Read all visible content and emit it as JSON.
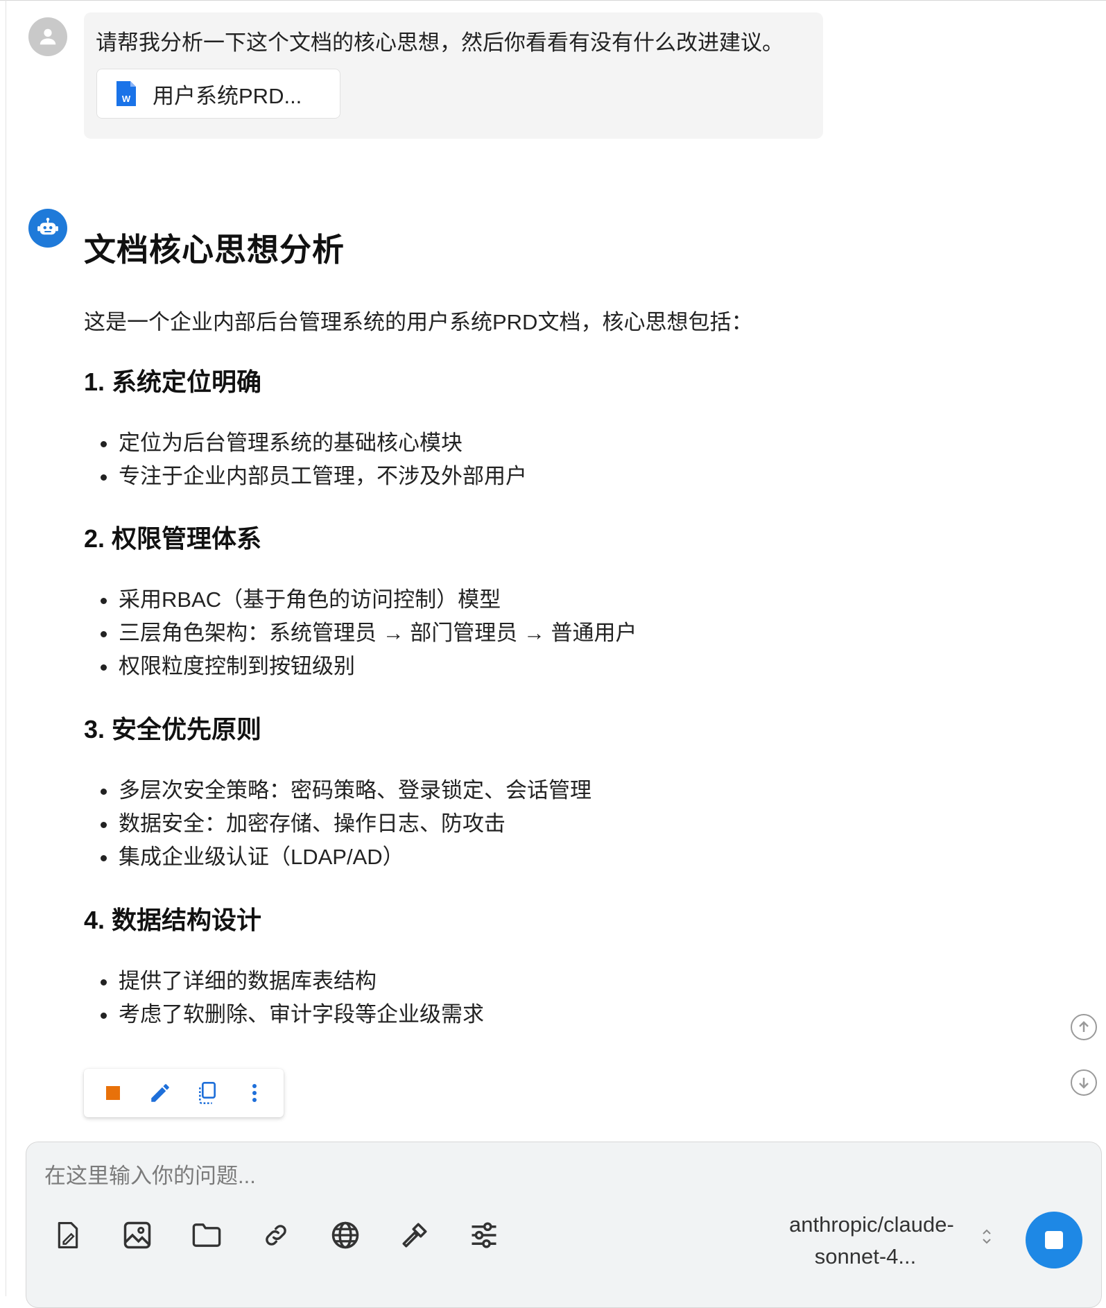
{
  "user_message": {
    "text": "请帮我分析一下这个文档的核心思想，然后你看看有没有什么改进建议。",
    "attachment": {
      "icon": "word-document-icon",
      "name": "用户系统PRD..."
    }
  },
  "assistant_message": {
    "title": "文档核心思想分析",
    "intro": "这是一个企业内部后台管理系统的用户系统PRD文档，核心思想包括：",
    "sections": [
      {
        "heading": "1. 系统定位明确",
        "bullets": [
          "定位为后台管理系统的基础核心模块",
          "专注于企业内部员工管理，不涉及外部用户"
        ]
      },
      {
        "heading": "2. 权限管理体系",
        "bullets": [
          "采用RBAC（基于角色的访问控制）模型",
          "三层角色架构：系统管理员 → 部门管理员 → 普通用户",
          "权限粒度控制到按钮级别"
        ]
      },
      {
        "heading": "3. 安全优先原则",
        "bullets": [
          "多层次安全策略：密码策略、登录锁定、会话管理",
          "数据安全：加密存储、操作日志、防攻击",
          "集成企业级认证（LDAP/AD）"
        ]
      },
      {
        "heading": "4. 数据结构设计",
        "bullets": [
          "提供了详细的数据库表结构",
          "考虑了软删除、审计字段等企业级需求"
        ]
      }
    ]
  },
  "message_actions": [
    "stop-square-icon",
    "edit-pencil-icon",
    "copy-icon",
    "more-vertical-icon"
  ],
  "scroll_controls": [
    "scroll-up-icon",
    "scroll-down-icon"
  ],
  "composer": {
    "placeholder": "在这里输入你的问题...",
    "tools": [
      "attach-document-icon",
      "image-icon",
      "folder-icon",
      "link-icon",
      "globe-icon",
      "hammer-icon",
      "settings-sliders-icon"
    ],
    "model_line1": "anthropic/claude-",
    "model_line2": "sonnet-4...",
    "send_state": "stop"
  },
  "colors": {
    "accent": "#1e88e5",
    "bot_avatar": "#1f7ad9",
    "stop_icon": "#e8710a",
    "composer_bg": "#f1f3f4",
    "bubble_bg": "#f4f4f4"
  }
}
